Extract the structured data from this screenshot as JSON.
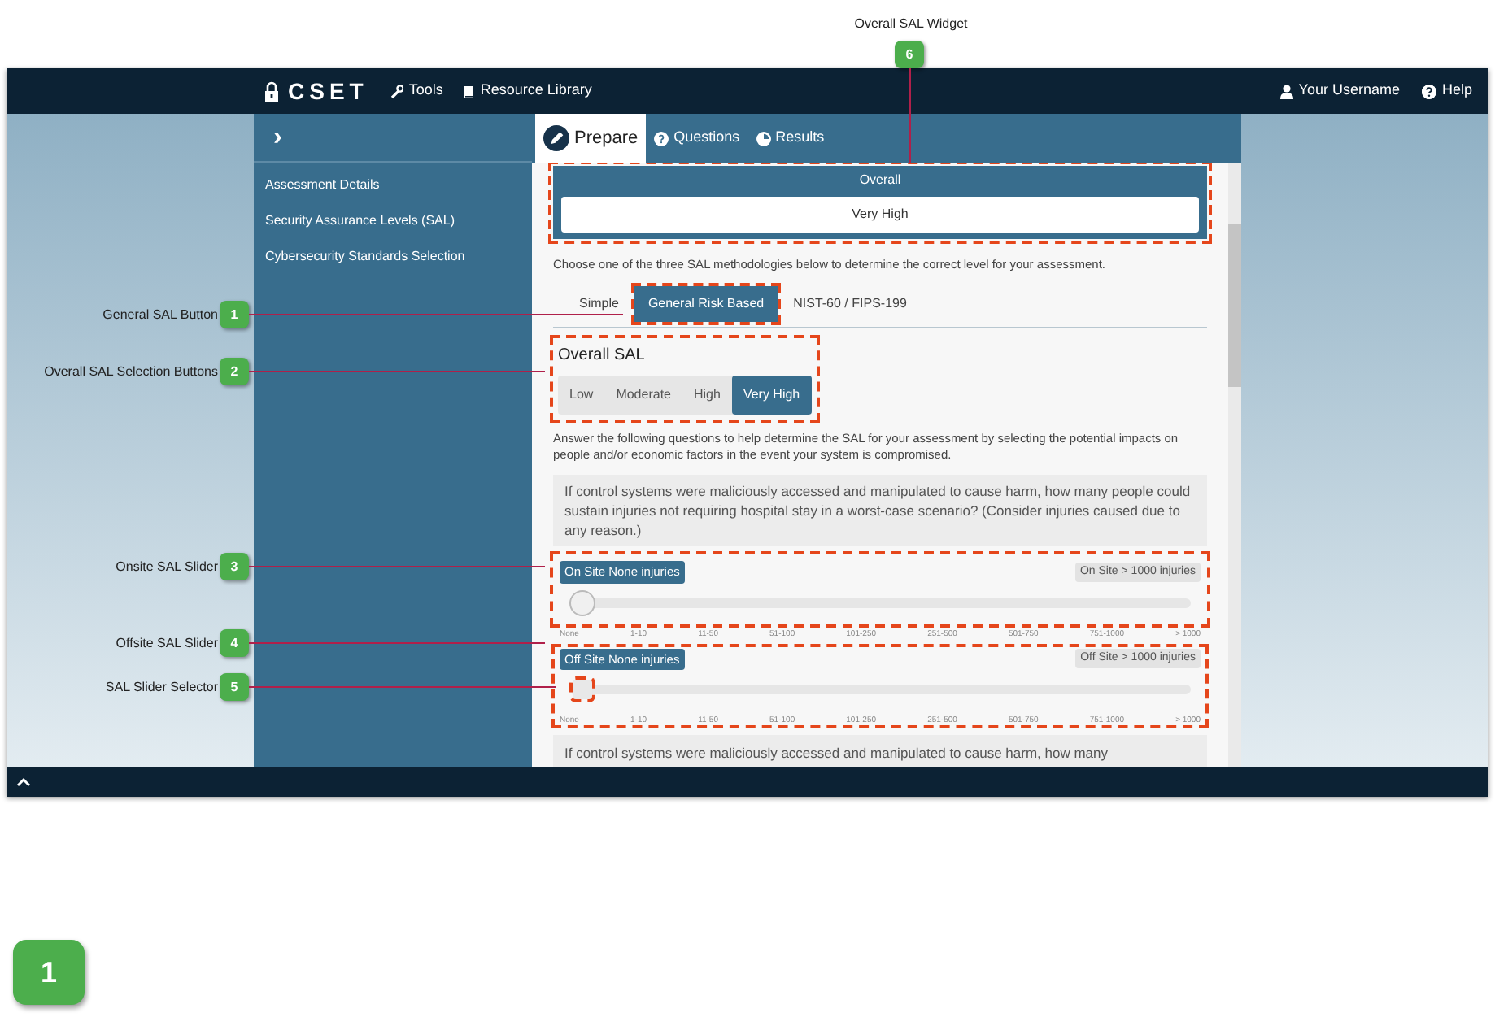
{
  "nav": {
    "logo": "CSET",
    "links": [
      "Tools",
      "Resource Library"
    ],
    "user": "Your Username",
    "help": "Help"
  },
  "sidebar": {
    "toggle": "›",
    "items": [
      "Assessment Details",
      "Security Assurance Levels (SAL)",
      "Cybersecurity Standards Selection"
    ]
  },
  "tabs": [
    {
      "label": "Prepare",
      "selected": true
    },
    {
      "label": "Questions",
      "selected": false
    },
    {
      "label": "Results",
      "selected": false
    }
  ],
  "overall_widget": {
    "title": "Overall",
    "value": "Very High"
  },
  "intro": "Choose one of the three SAL methodologies below to determine the correct level for your assessment.",
  "methods": [
    {
      "label": "Simple",
      "selected": false
    },
    {
      "label": "General Risk Based",
      "selected": true
    },
    {
      "label": "NIST-60 / FIPS-199",
      "selected": false
    }
  ],
  "overall_sal": {
    "heading": "Overall SAL",
    "levels": [
      {
        "label": "Low",
        "selected": false
      },
      {
        "label": "Moderate",
        "selected": false
      },
      {
        "label": "High",
        "selected": false
      },
      {
        "label": "Very High",
        "selected": true
      }
    ]
  },
  "instructions": "Answer the following questions to help determine the SAL for your assessment by selecting the potential impacts on people and/or economic factors in the event your system is compromised.",
  "question": "If control systems were maliciously accessed and manipulated to cause harm, how many people could sustain injuries not requiring hospital stay in a worst-case scenario? (Consider injuries caused due to any reason.)",
  "sliders": [
    {
      "label": "On Site None injuries",
      "max_label": "On Site > 1000 injuries",
      "level": 0,
      "ticks": [
        "None",
        "1-10",
        "11-50",
        "51-100",
        "101-250",
        "251-500",
        "501-750",
        "751-1000",
        "> 1000"
      ]
    },
    {
      "label": "Off Site None injuries",
      "max_label": "Off Site > 1000 injuries",
      "level": 0,
      "ticks": [
        "None",
        "1-10",
        "11-50",
        "51-100",
        "101-250",
        "251-500",
        "501-750",
        "751-1000",
        "> 1000"
      ]
    }
  ],
  "next_question": "If control systems were maliciously accessed and manipulated to cause harm, how many",
  "callouts": [
    {
      "number": "6",
      "label": "Overall SAL Widget"
    },
    {
      "number": "1",
      "label": "General SAL Button"
    },
    {
      "number": "2",
      "label": "Overall SAL Selection Buttons"
    },
    {
      "number": "3",
      "label": "Onsite SAL Slider"
    },
    {
      "number": "4",
      "label": "Offsite SAL Slider"
    },
    {
      "number": "5",
      "label": "SAL Slider Selector"
    }
  ],
  "legend_badge": "1"
}
